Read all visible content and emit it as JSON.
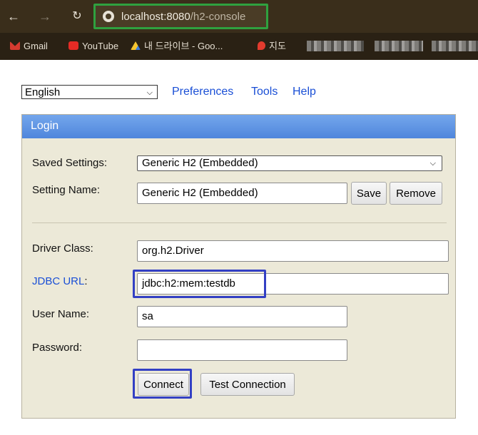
{
  "browser": {
    "url_host": "localhost:8080",
    "url_path": "/h2-console",
    "bookmarks": [
      "Gmail",
      "YouTube",
      "내 드라이브 - Goo...",
      "지도"
    ]
  },
  "top": {
    "language": "English",
    "links": [
      "Preferences",
      "Tools",
      "Help"
    ]
  },
  "login": {
    "title": "Login",
    "saved_settings_label": "Saved Settings:",
    "saved_settings_value": "Generic H2 (Embedded)",
    "setting_name_label": "Setting Name:",
    "setting_name_value": "Generic H2 (Embedded)",
    "save_label": "Save",
    "remove_label": "Remove",
    "driver_class_label": "Driver Class:",
    "driver_class_value": "org.h2.Driver",
    "jdbc_url_label": "JDBC URL",
    "jdbc_url_colon": ":",
    "jdbc_url_value": "jdbc:h2:mem:testdb",
    "user_name_label": "User Name:",
    "user_name_value": "sa",
    "password_label": "Password:",
    "password_value": "",
    "connect_label": "Connect",
    "test_connection_label": "Test Connection"
  },
  "colors": {
    "url_highlight": "#2fa13f",
    "annotation_highlight": "#3340c4",
    "panel_header": "#5b8fe0",
    "link": "#1a4fd6"
  }
}
